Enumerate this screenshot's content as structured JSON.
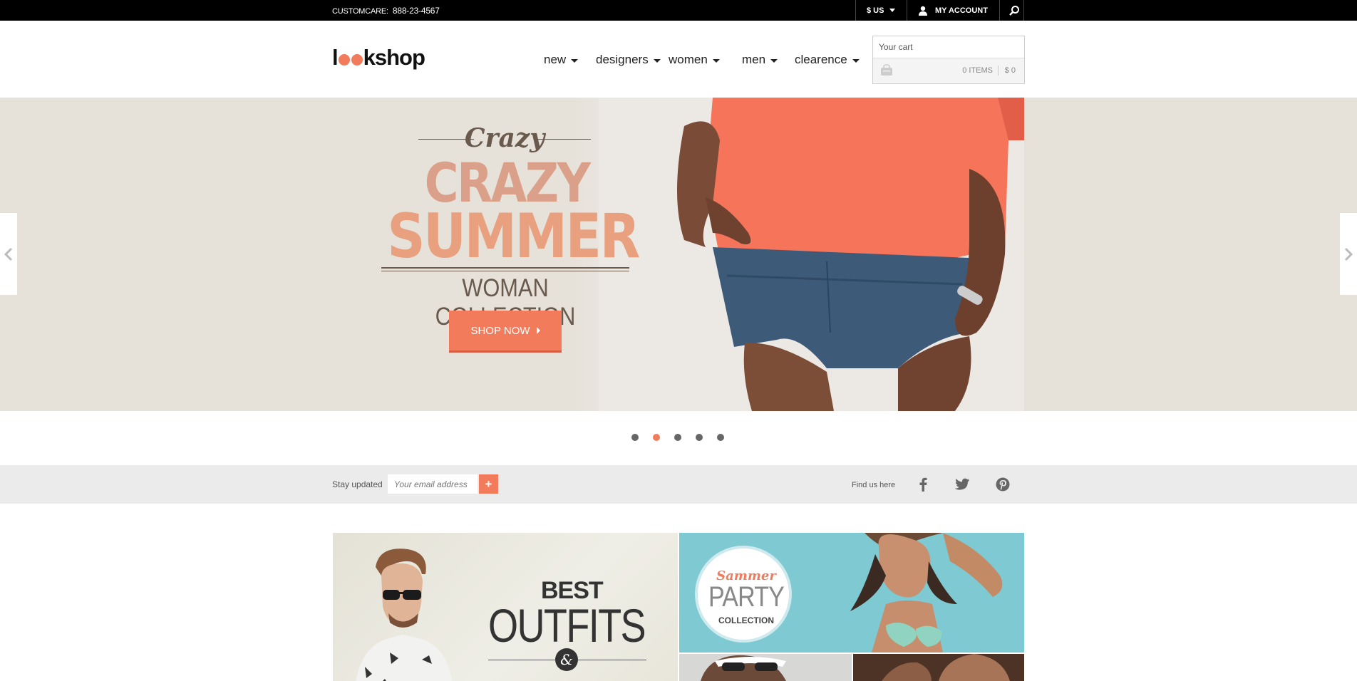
{
  "topbar": {
    "care_label": "CUSTOMCARE:",
    "care_phone": "888-23-4567",
    "currency": "$ US",
    "account": "MY ACCOUNT"
  },
  "logo": {
    "pre": "l",
    "post": "kshop"
  },
  "nav": [
    {
      "label": "new"
    },
    {
      "label": "designers"
    },
    {
      "label": "women"
    },
    {
      "label": "men"
    },
    {
      "label": "clearence"
    }
  ],
  "cart": {
    "title": "Your cart",
    "items": "0 ITEMS",
    "amount": "$ 0"
  },
  "hero": {
    "script_title": "Crazy",
    "line1": "CRAZY",
    "line2": "SUMMER",
    "subtitle": "WOMAN COLLECTION",
    "cta": "SHOP NOW",
    "slides_total": 5,
    "active_slide": 2
  },
  "newsletter": {
    "label": "Stay updated",
    "placeholder": "Your email address",
    "submit": "+",
    "find_label": "Find us here"
  },
  "social": [
    "facebook-icon",
    "twitter-icon",
    "pinterest-icon"
  ],
  "banners": {
    "outfits": {
      "word1": "BEST",
      "word2": "OUTFITS",
      "amp": "&"
    },
    "party": {
      "script": "Sammer",
      "big": "PARTY",
      "small": "COLLECTION"
    }
  },
  "colors": {
    "accent": "#f27b5c",
    "topbar": "#000000",
    "newsletter_bg": "#ebebeb"
  }
}
